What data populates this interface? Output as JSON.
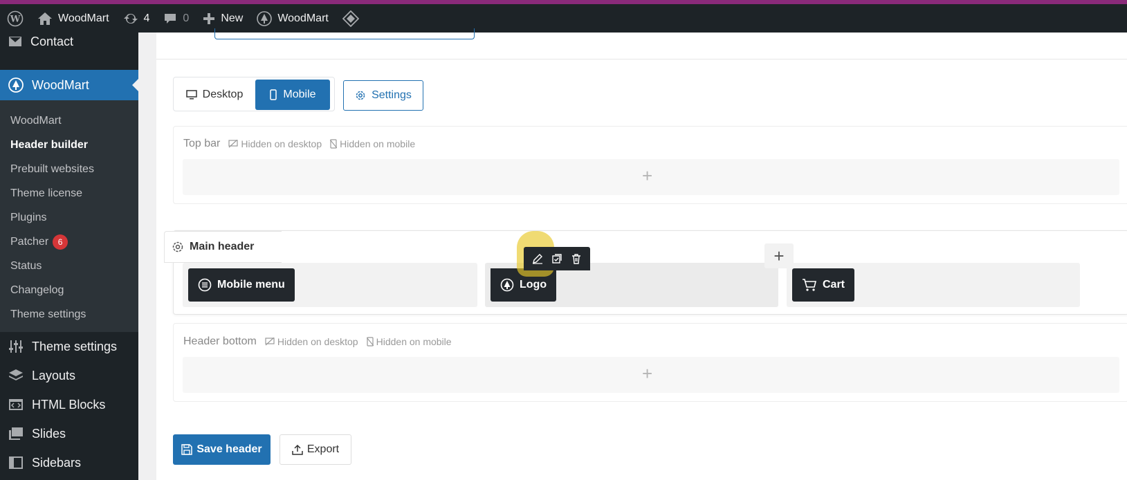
{
  "adminbar": {
    "site_name": "WoodMart",
    "updates_count": "4",
    "comments_count": "0",
    "new_label": "New",
    "theme_label": "WoodMart"
  },
  "sidebar": {
    "contact_label": "Contact",
    "woodmart_label": "WoodMart",
    "submenu": [
      {
        "label": "WoodMart"
      },
      {
        "label": "Header builder"
      },
      {
        "label": "Prebuilt websites"
      },
      {
        "label": "Theme license"
      },
      {
        "label": "Plugins"
      },
      {
        "label": "Patcher",
        "badge": "6"
      },
      {
        "label": "Status"
      },
      {
        "label": "Changelog"
      },
      {
        "label": "Theme settings"
      }
    ],
    "bottom_items": [
      {
        "label": "Theme settings",
        "icon": "sliders-icon"
      },
      {
        "label": "Layouts",
        "icon": "layers-icon"
      },
      {
        "label": "HTML Blocks",
        "icon": "code-block-icon"
      },
      {
        "label": "Slides",
        "icon": "slides-icon"
      },
      {
        "label": "Sidebars",
        "icon": "sidebar-icon"
      }
    ]
  },
  "builder": {
    "tabs": {
      "desktop": "Desktop",
      "mobile": "Mobile"
    },
    "settings_label": "Settings",
    "top_bar": {
      "title": "Top bar",
      "hidden_desktop": "Hidden on desktop",
      "hidden_mobile": "Hidden on mobile"
    },
    "main_header": {
      "title": "Main header",
      "elements": {
        "mobile_menu": "Mobile menu",
        "logo": "Logo",
        "cart": "Cart"
      }
    },
    "header_bottom": {
      "title": "Header bottom",
      "hidden_desktop": "Hidden on desktop",
      "hidden_mobile": "Hidden on mobile"
    },
    "save_label": "Save header",
    "export_label": "Export"
  },
  "colors": {
    "accent": "#2271b1",
    "sidebar_bg": "#1d2327",
    "badge": "#d63638",
    "highlight": "#e8c828"
  }
}
